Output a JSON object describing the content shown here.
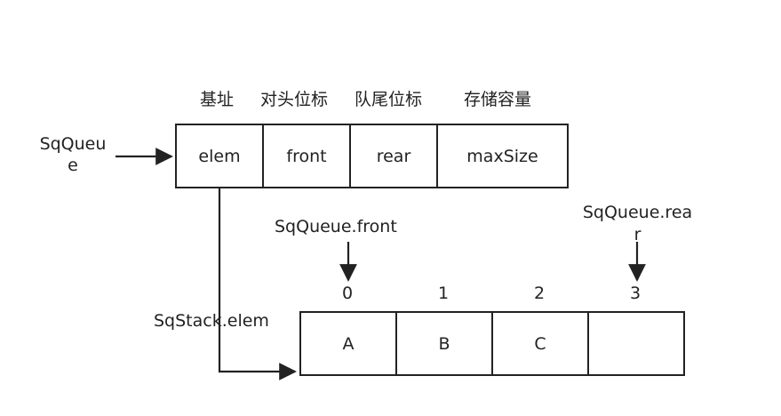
{
  "struct": {
    "headers": [
      "基址",
      "对头位标",
      "队尾位标",
      "存储容量"
    ],
    "fields": [
      "elem",
      "front",
      "rear",
      "maxSize"
    ],
    "pointer_label_lines": [
      "SqQueu",
      "e"
    ]
  },
  "array": {
    "cells": [
      "A",
      "B",
      "C",
      ""
    ],
    "indices": [
      "0",
      "1",
      "2",
      "3"
    ],
    "pointer_label": "SqStack.elem"
  },
  "front_pointer": {
    "label": "SqQueue.front"
  },
  "rear_pointer": {
    "label_lines": [
      "SqQueue.rea",
      "r"
    ]
  },
  "colors": {
    "stroke": "#222222",
    "text": "#222222",
    "background": "#ffffff"
  }
}
